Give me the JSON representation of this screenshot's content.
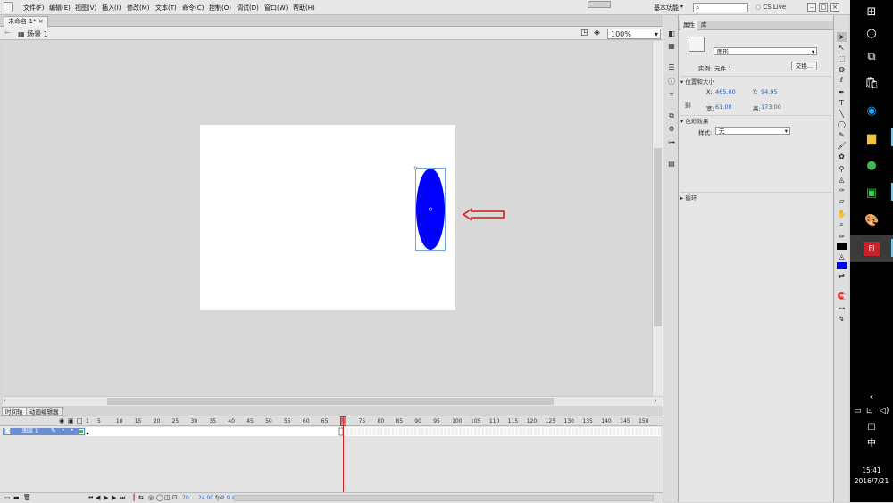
{
  "menubar": {
    "items": [
      "文件(F)",
      "编辑(E)",
      "视图(V)",
      "插入(I)",
      "修改(M)",
      "文本(T)",
      "命令(C)",
      "控制(O)",
      "调试(D)",
      "窗口(W)",
      "帮助(H)"
    ],
    "workspace": "基本功能",
    "cslive": "CS Live"
  },
  "document": {
    "tab": "未命名-1*"
  },
  "editbar": {
    "scene": "场景 1",
    "zoom": "100%"
  },
  "timeline": {
    "tabs": [
      "时间轴",
      "动画编辑器"
    ],
    "frame_numbers": [
      "1",
      "5",
      "10",
      "15",
      "20",
      "25",
      "30",
      "35",
      "40",
      "45",
      "50",
      "55",
      "60",
      "65",
      "70",
      "75",
      "80",
      "85",
      "90",
      "95",
      "100",
      "105",
      "110",
      "115",
      "120",
      "125",
      "130",
      "135",
      "140",
      "145",
      "150"
    ],
    "layer_name": "图层 1",
    "current_frame": "70",
    "fps": "24.00",
    "fps_unit": "fps",
    "time": "2.9 s"
  },
  "properties": {
    "tabs": [
      "属性",
      "库"
    ],
    "symbol_type": "图形",
    "instance_label": "实例:",
    "instance_value": "元件 1",
    "swap_button": "交换...",
    "position_section": "位置和大小",
    "x_label": "X:",
    "x_value": "465.00",
    "y_label": "Y:",
    "y_value": "94.95",
    "w_label": "宽:",
    "w_value": "61.00",
    "h_label": "高:",
    "h_value": "173.00",
    "color_section": "色彩效果",
    "style_label": "样式:",
    "style_value": "无",
    "loop_section": "循环"
  },
  "colors": {
    "ellipse": "#0000ff",
    "arrow": "#d9302f",
    "playhead": "#d42020"
  },
  "taskbar": {
    "time": "15:41",
    "date": "2016/7/21",
    "ime": "中",
    "flash_app": "Fl"
  }
}
